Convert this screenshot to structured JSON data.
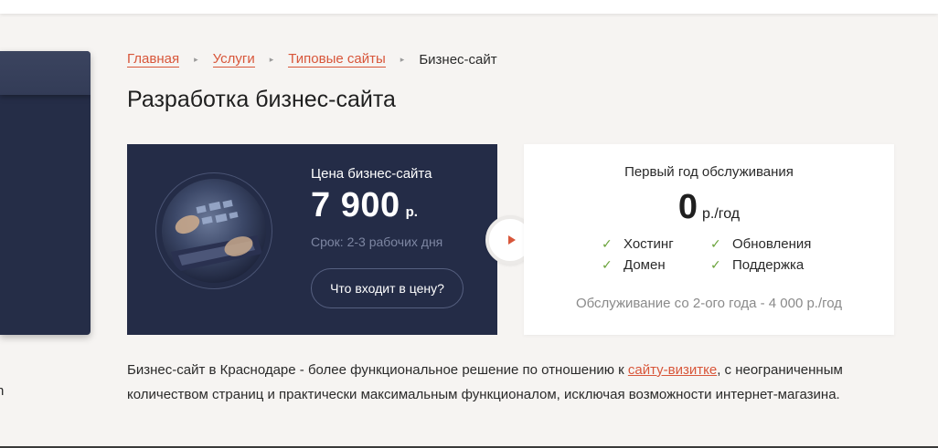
{
  "breadcrumb": {
    "items": [
      "Главная",
      "Услуги",
      "Типовые сайты"
    ],
    "current": "Бизнес-сайт"
  },
  "page_title": "Разработка бизнес-сайта",
  "price_card": {
    "label": "Цена бизнес-сайта",
    "price": "7 900",
    "currency": "р.",
    "term": "Срок: 2-3 рабочих дня",
    "includes_button": "Что входит в цену?"
  },
  "service_card": {
    "title": "Первый год обслуживания",
    "price": "0",
    "unit": "р./год",
    "features": [
      "Хостинг",
      "Обновления",
      "Домен",
      "Поддержка"
    ],
    "note": "Обслуживание со 2-ого года - 4 000 р./год"
  },
  "description": {
    "text_before": "Бизнес-сайт в Краснодаре - более функциональное решение по отношению к ",
    "link": "сайту-визитке",
    "text_after": ", с неограниченным количеством страниц и практически максимальным функционалом, исключая возможности интернет-магазина."
  },
  "side_fragment": "n",
  "colors": {
    "accent": "#d8563a",
    "dark_card": "#242c47",
    "check": "#6aa33a",
    "background": "#f6f4f2"
  }
}
